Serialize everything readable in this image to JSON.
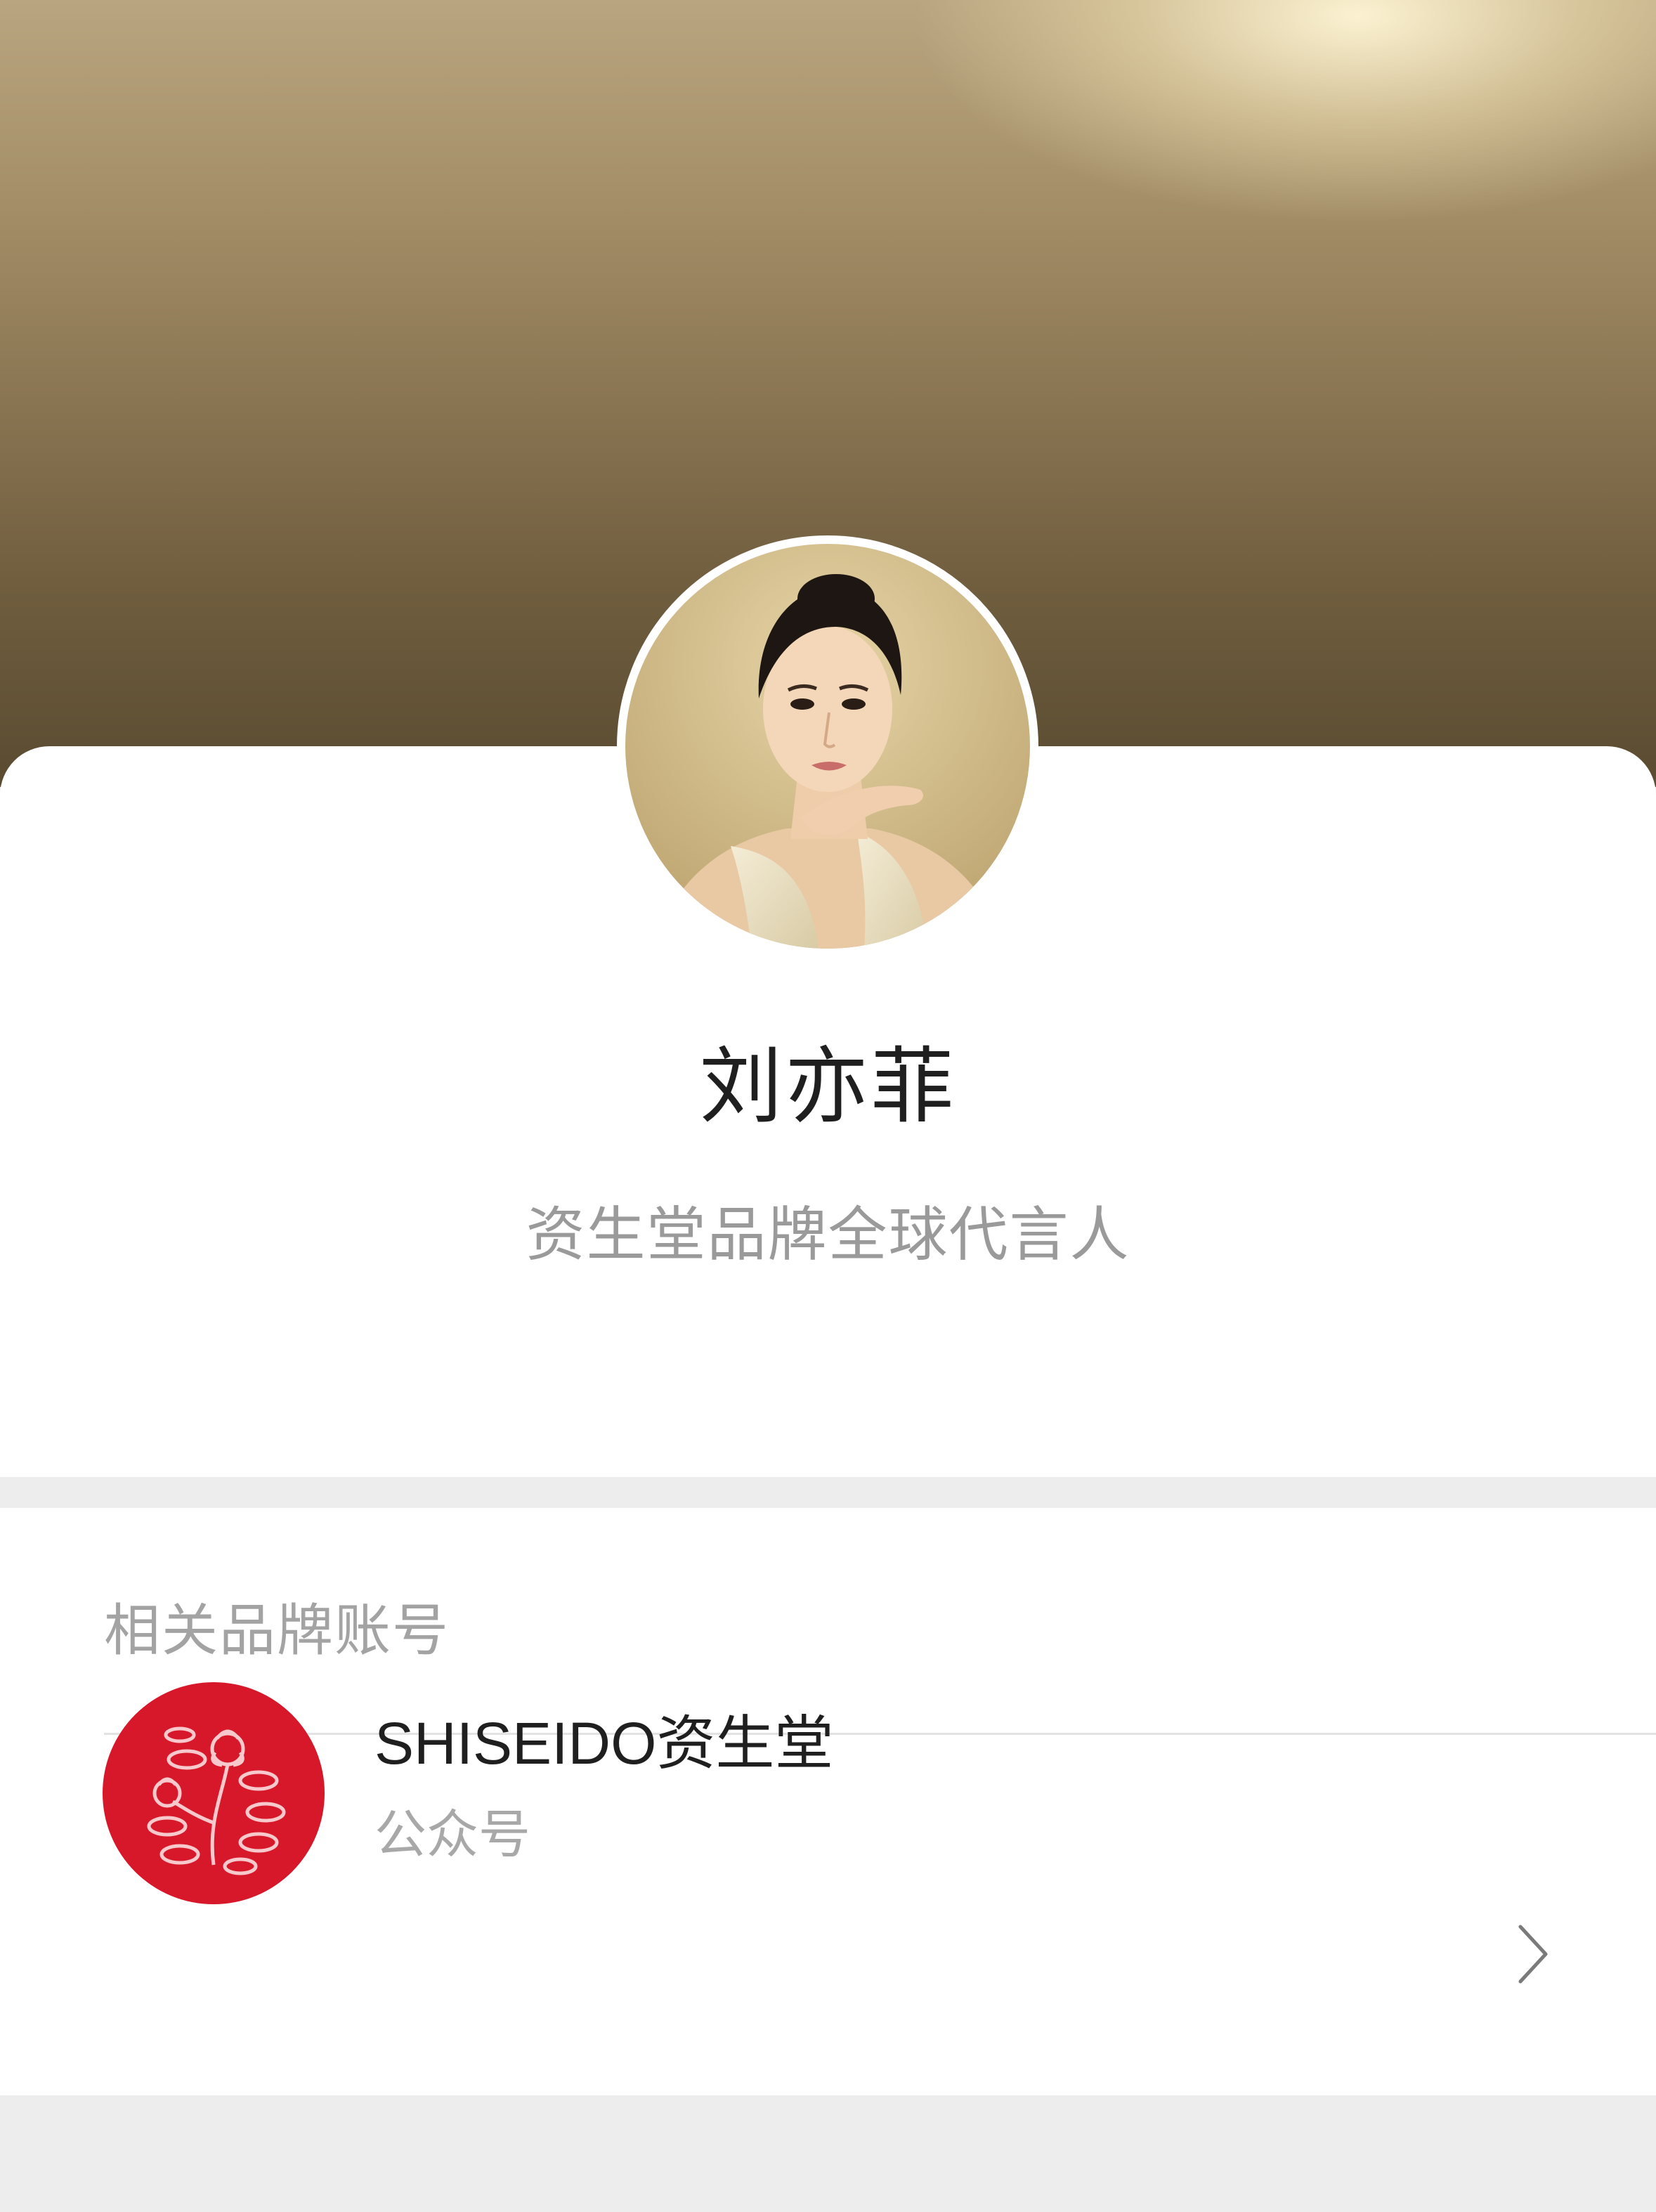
{
  "profile": {
    "name": "刘亦菲",
    "description": "资生堂品牌全球代言人",
    "avatar_icon": "person-portrait-photo"
  },
  "related": {
    "section_title": "相关品牌账号",
    "items": [
      {
        "name": "SHISEIDO资生堂",
        "type": "公众号",
        "logo_icon": "shiseido-camellia-logo",
        "logo_color": "#d7182a",
        "chevron_icon": "chevron-right-icon"
      }
    ]
  },
  "colors": {
    "header_gold_light": "#f0e0b4",
    "header_gold_dark": "#5a4b31",
    "page_bg": "#ededed",
    "card_bg": "#ffffff"
  }
}
